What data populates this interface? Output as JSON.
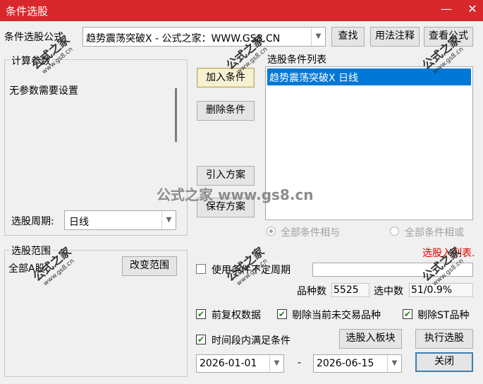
{
  "window": {
    "title": "条件选股",
    "minimize": "—",
    "close": "✕"
  },
  "top": {
    "formula_label": "条件选股公式",
    "formula_value": "趋势震荡突破X  -  公式之家：WWW.GS8.CN",
    "find": "查找",
    "usage": "用法注释",
    "view_formula": "查看公式"
  },
  "params": {
    "group_label": "计算参数",
    "no_params": "无参数需要设置",
    "period_label": "选股周期:",
    "period_value": "日线"
  },
  "actions": {
    "add": "加入条件",
    "delete": "删除条件",
    "import": "引入方案",
    "save": "保存方案"
  },
  "conditions": {
    "label": "选股条件列表",
    "items": [
      "趋势震荡突破X  日线"
    ],
    "and_label": "全部条件相与",
    "or_label": "全部条件相或",
    "selected_mode": "and"
  },
  "range": {
    "group_label": "选股范围",
    "value": "全部A股",
    "change": "改变范围"
  },
  "right_panel": {
    "to_list": "选股入列表.",
    "use_period_label": "使用条件不定周期",
    "use_period_checked": false,
    "count_label": "品种数",
    "count_value": "5525",
    "selected_label": "选中数",
    "selected_value": "51/0.9%"
  },
  "options": {
    "fuquan": {
      "label": "前复权数据",
      "checked": true
    },
    "skip_untraded": {
      "label": "剔除当前未交易品种",
      "checked": true
    },
    "skip_st": {
      "label": "剔除ST品种",
      "checked": true
    },
    "time_range": {
      "label": "时间段内满足条件",
      "checked": true
    }
  },
  "bottom": {
    "to_block": "选股入板块",
    "execute": "执行选股",
    "close": "关闭",
    "date_from": "2026-01-01",
    "date_sep": "-",
    "date_to": "2026-06-15"
  },
  "watermark": {
    "text": "公式之家",
    "url": "www.gs8.cn",
    "center": "公式之家 www.gs8.cn"
  },
  "colors": {
    "title_bg": "#d8282b",
    "selected_bg": "#0078d7",
    "accent_red": "#e00000"
  }
}
